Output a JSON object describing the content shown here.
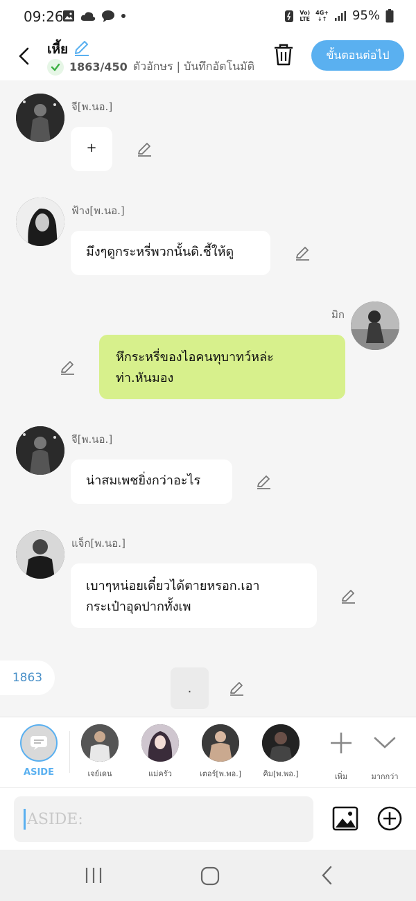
{
  "status": {
    "time": "09:26",
    "volte_top": "Vo)",
    "volte_bottom": "LTE",
    "net_top": "4G+",
    "net_bottom": "↓↑",
    "battery": "95%"
  },
  "header": {
    "title": "เหี้ย",
    "count": "1863/450",
    "info": "ตัวอักษร | บันทึกอัตโนมัติห",
    "next_label": "ขั้นตอนต่อไป"
  },
  "messages": [
    {
      "sender": "จี[พ.นอ.]",
      "text": "+"
    },
    {
      "sender": "ฟ้าง[พ.นอ.]",
      "text": "มึงๆดูกระหรี่พวกนั้นดิ.ชี้ให้ดู"
    },
    {
      "sender": "มิก",
      "line1": "หึกระหรี่ของไอคนทุบาทว์หล่ะ",
      "line2": "ท่า.หันมอง"
    },
    {
      "sender": "จี[พ.นอ.]",
      "text": "น่าสมเพชยิ่งกว่าอะไร"
    },
    {
      "sender": "แจ็ก[พ.นอ.]",
      "line1": "เบาๆหน่อยเดี๋ยวได้ตายหรอก.เอา",
      "line2": "กระเป๋าอุดปากทั้งเพ"
    }
  ],
  "draft": {
    "counter": "1863",
    "text": "."
  },
  "characters": {
    "aside": "ASIDE",
    "items": [
      "เจย์เดน",
      "แม่ครัว",
      "เตอร์[พ.พอ.]",
      "คิม[พ.พอ.]"
    ],
    "add_label": "เพิ่ม",
    "more_label": "มากกว่า"
  },
  "input": {
    "placeholder": "ASIDE:"
  },
  "colors": {
    "accent": "#5ab0f0",
    "own_bubble": "#d7f08c",
    "background": "#f5f5f5"
  }
}
